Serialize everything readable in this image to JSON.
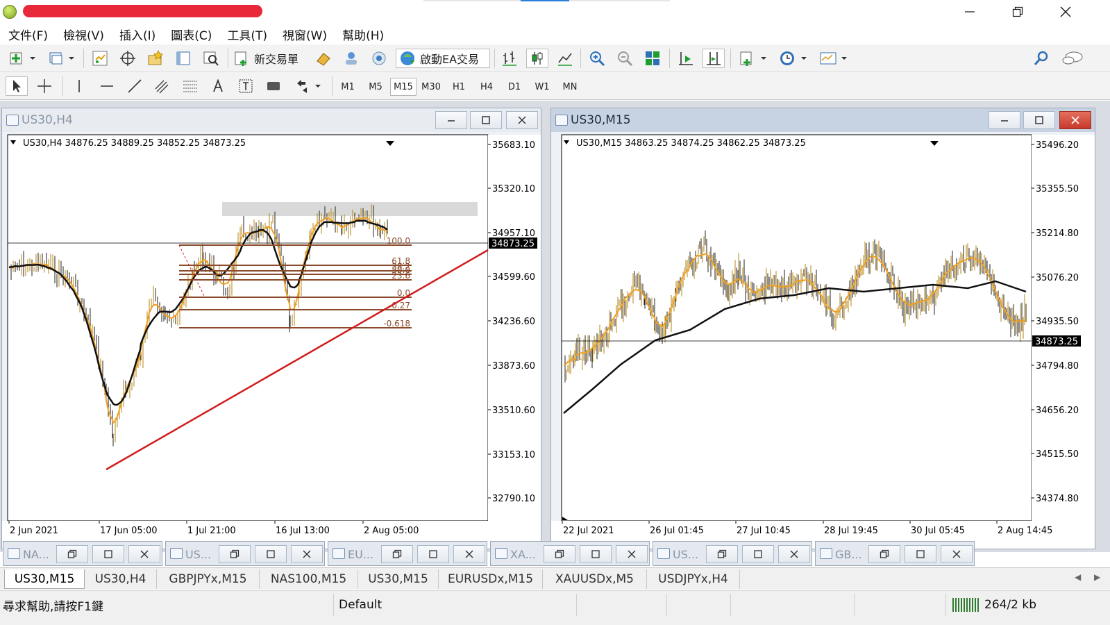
{
  "window": {
    "title": "",
    "minimize_icon": "minimize-icon",
    "restore_icon": "restore-icon",
    "close_icon": "close-icon"
  },
  "menu": [
    "文件(F)",
    "檢視(V)",
    "插入(I)",
    "圖表(C)",
    "工具(T)",
    "視窗(W)",
    "幫助(H)"
  ],
  "toolbar": {
    "new_order_label": "新交易單",
    "auto_trading_label": "啟動EA交易"
  },
  "timeframes": [
    "M1",
    "M5",
    "M15",
    "M30",
    "H1",
    "H4",
    "D1",
    "W1",
    "MN"
  ],
  "active_timeframe": "M15",
  "charts": [
    {
      "window_title": "US30,H4",
      "header": "US30,H4  34876.25 34889.25 34852.25 34873.25",
      "symbol": "US30",
      "period": "H4",
      "ohlc": {
        "open": 34876.25,
        "high": 34889.25,
        "low": 34852.25,
        "close": 34873.25
      },
      "current_price_label": "34873.25",
      "price_axis": [
        "35683.10",
        "35320.10",
        "34957.10",
        "34599.60",
        "34236.60",
        "33873.60",
        "33510.60",
        "33153.10",
        "32790.10"
      ],
      "time_axis": [
        "2 Jun 2021",
        "17 Jun 05:00",
        "1 Jul 21:00",
        "16 Jul 13:00",
        "2 Aug 05:00"
      ],
      "fibonacci_levels": [
        "100.0",
        "61.8",
        "38.2",
        "50.0",
        "23.6",
        "0.0",
        "0.27",
        "-0.618"
      ],
      "fib_colour": "#8b4a2b",
      "trendline_colour": "#d01c1c"
    },
    {
      "window_title": "US30,M15",
      "header": "US30,M15  34863.25 34874.25 34862.25 34873.25",
      "symbol": "US30",
      "period": "M15",
      "ohlc": {
        "open": 34863.25,
        "high": 34874.25,
        "low": 34862.25,
        "close": 34873.25
      },
      "current_price_label": "34873.25",
      "price_axis": [
        "35496.20",
        "35355.50",
        "35214.80",
        "35076.20",
        "34935.50",
        "34794.80",
        "34656.20",
        "34515.50",
        "34374.80"
      ],
      "time_axis": [
        "22 Jul 2021",
        "26 Jul 01:45",
        "27 Jul 10:45",
        "28 Jul 19:45",
        "30 Jul 05:45",
        "2 Aug 14:45"
      ]
    }
  ],
  "minimized_windows": [
    "NA...",
    "US...",
    "EU...",
    "XA...",
    "US...",
    "GB..."
  ],
  "chart_tabs": [
    "US30,M15",
    "US30,H4",
    "GBPJPYx,M15",
    "NAS100,M15",
    "US30,M15",
    "EURUSDx,M15",
    "XAUUSDx,M5",
    "USDJPYx,H4"
  ],
  "active_tab": 0,
  "status": {
    "help_text": "尋求幫助,請按F1鍵",
    "profile": "Default",
    "traffic": "264/2 kb"
  },
  "colors": {
    "ma_fast": "#f0a020",
    "ma_slow": "#111111",
    "candle_up": "#b5830f",
    "candle_down": "#222222",
    "redaction": "#e8293a"
  }
}
